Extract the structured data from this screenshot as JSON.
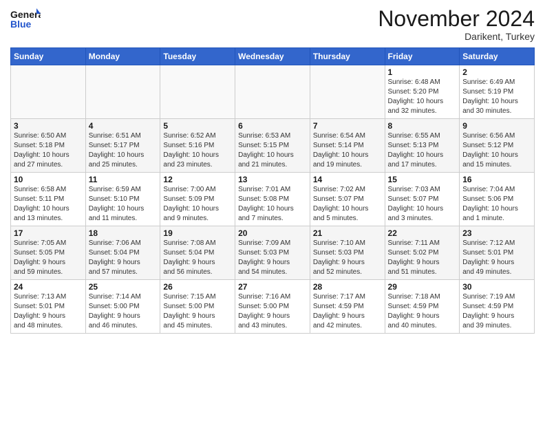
{
  "header": {
    "logo_general": "General",
    "logo_blue": "Blue",
    "month_title": "November 2024",
    "location": "Darikent, Turkey"
  },
  "weekdays": [
    "Sunday",
    "Monday",
    "Tuesday",
    "Wednesday",
    "Thursday",
    "Friday",
    "Saturday"
  ],
  "weeks": [
    {
      "row_bg": "white",
      "days": [
        {
          "num": "",
          "info": "",
          "empty": true
        },
        {
          "num": "",
          "info": "",
          "empty": true
        },
        {
          "num": "",
          "info": "",
          "empty": true
        },
        {
          "num": "",
          "info": "",
          "empty": true
        },
        {
          "num": "",
          "info": "",
          "empty": true
        },
        {
          "num": "1",
          "info": "Sunrise: 6:48 AM\nSunset: 5:20 PM\nDaylight: 10 hours\nand 32 minutes.",
          "empty": false
        },
        {
          "num": "2",
          "info": "Sunrise: 6:49 AM\nSunset: 5:19 PM\nDaylight: 10 hours\nand 30 minutes.",
          "empty": false
        }
      ]
    },
    {
      "row_bg": "gray",
      "days": [
        {
          "num": "3",
          "info": "Sunrise: 6:50 AM\nSunset: 5:18 PM\nDaylight: 10 hours\nand 27 minutes.",
          "empty": false
        },
        {
          "num": "4",
          "info": "Sunrise: 6:51 AM\nSunset: 5:17 PM\nDaylight: 10 hours\nand 25 minutes.",
          "empty": false
        },
        {
          "num": "5",
          "info": "Sunrise: 6:52 AM\nSunset: 5:16 PM\nDaylight: 10 hours\nand 23 minutes.",
          "empty": false
        },
        {
          "num": "6",
          "info": "Sunrise: 6:53 AM\nSunset: 5:15 PM\nDaylight: 10 hours\nand 21 minutes.",
          "empty": false
        },
        {
          "num": "7",
          "info": "Sunrise: 6:54 AM\nSunset: 5:14 PM\nDaylight: 10 hours\nand 19 minutes.",
          "empty": false
        },
        {
          "num": "8",
          "info": "Sunrise: 6:55 AM\nSunset: 5:13 PM\nDaylight: 10 hours\nand 17 minutes.",
          "empty": false
        },
        {
          "num": "9",
          "info": "Sunrise: 6:56 AM\nSunset: 5:12 PM\nDaylight: 10 hours\nand 15 minutes.",
          "empty": false
        }
      ]
    },
    {
      "row_bg": "white",
      "days": [
        {
          "num": "10",
          "info": "Sunrise: 6:58 AM\nSunset: 5:11 PM\nDaylight: 10 hours\nand 13 minutes.",
          "empty": false
        },
        {
          "num": "11",
          "info": "Sunrise: 6:59 AM\nSunset: 5:10 PM\nDaylight: 10 hours\nand 11 minutes.",
          "empty": false
        },
        {
          "num": "12",
          "info": "Sunrise: 7:00 AM\nSunset: 5:09 PM\nDaylight: 10 hours\nand 9 minutes.",
          "empty": false
        },
        {
          "num": "13",
          "info": "Sunrise: 7:01 AM\nSunset: 5:08 PM\nDaylight: 10 hours\nand 7 minutes.",
          "empty": false
        },
        {
          "num": "14",
          "info": "Sunrise: 7:02 AM\nSunset: 5:07 PM\nDaylight: 10 hours\nand 5 minutes.",
          "empty": false
        },
        {
          "num": "15",
          "info": "Sunrise: 7:03 AM\nSunset: 5:07 PM\nDaylight: 10 hours\nand 3 minutes.",
          "empty": false
        },
        {
          "num": "16",
          "info": "Sunrise: 7:04 AM\nSunset: 5:06 PM\nDaylight: 10 hours\nand 1 minute.",
          "empty": false
        }
      ]
    },
    {
      "row_bg": "gray",
      "days": [
        {
          "num": "17",
          "info": "Sunrise: 7:05 AM\nSunset: 5:05 PM\nDaylight: 9 hours\nand 59 minutes.",
          "empty": false
        },
        {
          "num": "18",
          "info": "Sunrise: 7:06 AM\nSunset: 5:04 PM\nDaylight: 9 hours\nand 57 minutes.",
          "empty": false
        },
        {
          "num": "19",
          "info": "Sunrise: 7:08 AM\nSunset: 5:04 PM\nDaylight: 9 hours\nand 56 minutes.",
          "empty": false
        },
        {
          "num": "20",
          "info": "Sunrise: 7:09 AM\nSunset: 5:03 PM\nDaylight: 9 hours\nand 54 minutes.",
          "empty": false
        },
        {
          "num": "21",
          "info": "Sunrise: 7:10 AM\nSunset: 5:03 PM\nDaylight: 9 hours\nand 52 minutes.",
          "empty": false
        },
        {
          "num": "22",
          "info": "Sunrise: 7:11 AM\nSunset: 5:02 PM\nDaylight: 9 hours\nand 51 minutes.",
          "empty": false
        },
        {
          "num": "23",
          "info": "Sunrise: 7:12 AM\nSunset: 5:01 PM\nDaylight: 9 hours\nand 49 minutes.",
          "empty": false
        }
      ]
    },
    {
      "row_bg": "white",
      "days": [
        {
          "num": "24",
          "info": "Sunrise: 7:13 AM\nSunset: 5:01 PM\nDaylight: 9 hours\nand 48 minutes.",
          "empty": false
        },
        {
          "num": "25",
          "info": "Sunrise: 7:14 AM\nSunset: 5:00 PM\nDaylight: 9 hours\nand 46 minutes.",
          "empty": false
        },
        {
          "num": "26",
          "info": "Sunrise: 7:15 AM\nSunset: 5:00 PM\nDaylight: 9 hours\nand 45 minutes.",
          "empty": false
        },
        {
          "num": "27",
          "info": "Sunrise: 7:16 AM\nSunset: 5:00 PM\nDaylight: 9 hours\nand 43 minutes.",
          "empty": false
        },
        {
          "num": "28",
          "info": "Sunrise: 7:17 AM\nSunset: 4:59 PM\nDaylight: 9 hours\nand 42 minutes.",
          "empty": false
        },
        {
          "num": "29",
          "info": "Sunrise: 7:18 AM\nSunset: 4:59 PM\nDaylight: 9 hours\nand 40 minutes.",
          "empty": false
        },
        {
          "num": "30",
          "info": "Sunrise: 7:19 AM\nSunset: 4:59 PM\nDaylight: 9 hours\nand 39 minutes.",
          "empty": false
        }
      ]
    }
  ]
}
